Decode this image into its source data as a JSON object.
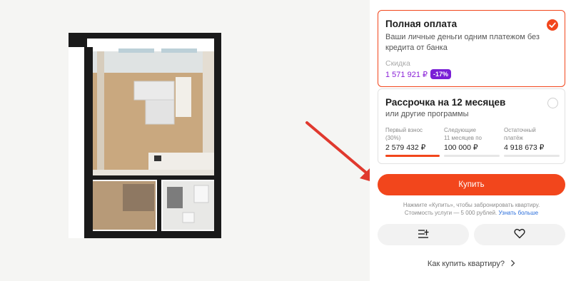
{
  "full_payment": {
    "title": "Полная оплата",
    "description_line1": "Ваши личные деньги одним платежом без",
    "description_line2": "кредита от банка",
    "discount_label": "Скидка",
    "discount_price": "1 571 921 ₽",
    "discount_badge": "-17%",
    "selected": true
  },
  "installment": {
    "title": "Рассрочка на 12 месяцев",
    "subtitle": "или другие программы",
    "selected": false,
    "columns": [
      {
        "label_line1": "Первый взнос",
        "label_line2": "(30%)",
        "value": "2 579 432 ₽"
      },
      {
        "label_line1": "Следующие",
        "label_line2": "11 месяцев по",
        "value": "100 000 ₽"
      },
      {
        "label_line1": "Остаточный",
        "label_line2": "платёж",
        "value": "4 918 673 ₽"
      }
    ]
  },
  "buy_button": "Купить",
  "note": {
    "line1": "Нажмите «Купить», чтобы забронировать квартиру.",
    "line2": "Стоимость услуги — 5 000 рублей.",
    "link": "Узнать больше"
  },
  "how_to_buy": "Как купить квартиру?",
  "icons": {
    "add_list": "add-to-list-icon",
    "favorite": "heart-icon",
    "chevron": "chevron-right-icon",
    "check": "checkmark-icon"
  },
  "colors": {
    "accent": "#f2461c",
    "discount": "#7a1fd6",
    "arrow": "#e0392e",
    "link": "#2a6edb"
  }
}
